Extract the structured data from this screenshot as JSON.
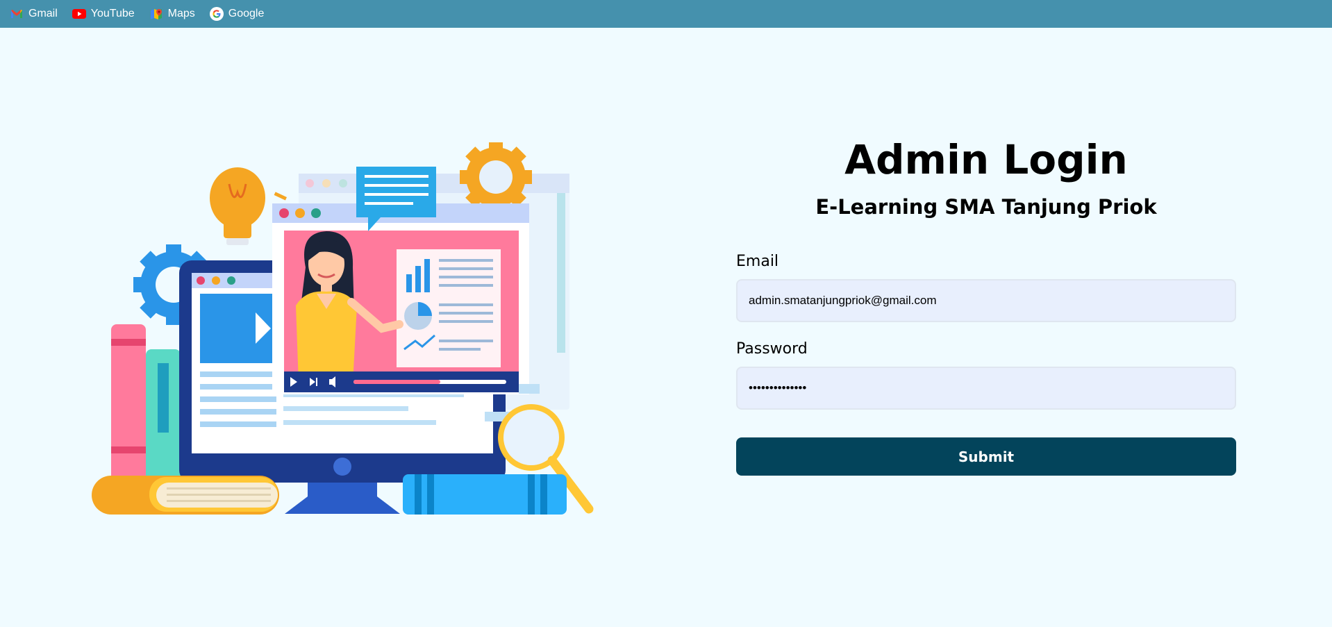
{
  "bookmarks": [
    {
      "label": "Gmail",
      "icon": "gmail-icon"
    },
    {
      "label": "YouTube",
      "icon": "youtube-icon"
    },
    {
      "label": "Maps",
      "icon": "maps-icon"
    },
    {
      "label": "Google",
      "icon": "google-icon"
    }
  ],
  "login": {
    "title": "Admin Login",
    "subtitle": "E-Learning SMA Tanjung Priok",
    "email_label": "Email",
    "email_value": "admin.smatanjungpriok@gmail.com",
    "password_label": "Password",
    "password_value": "••••••••••••••",
    "submit_label": "Submit"
  },
  "colors": {
    "bookmark_bar": "#4591ad",
    "page_background": "#f0fbff",
    "input_background": "#e8effd",
    "submit_button": "#03445b"
  }
}
